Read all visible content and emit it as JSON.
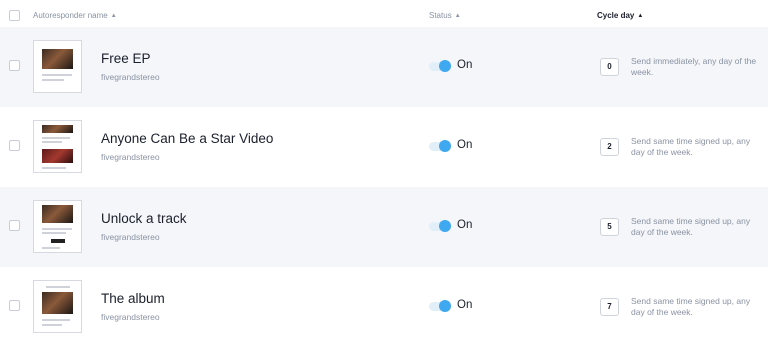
{
  "header": {
    "name_label": "Autoresponder name",
    "status_label": "Status",
    "cycle_label": "Cycle day"
  },
  "rows": [
    {
      "title": "Free EP",
      "sender": "fivegrandstereo",
      "status": "On",
      "day": "0",
      "description": "Send immediately, any day of the week."
    },
    {
      "title": "Anyone Can Be a Star Video",
      "sender": "fivegrandstereo",
      "status": "On",
      "day": "2",
      "description": "Send same time signed up, any day of the week."
    },
    {
      "title": "Unlock a track",
      "sender": "fivegrandstereo",
      "status": "On",
      "day": "5",
      "description": "Send same time signed up, any day of the week."
    },
    {
      "title": "The album",
      "sender": "fivegrandstereo",
      "status": "On",
      "day": "7",
      "description": "Send same time signed up, any day of the week."
    }
  ],
  "colors": {
    "accent": "#3ea8f0",
    "row_alt": "#f4f6f9"
  }
}
